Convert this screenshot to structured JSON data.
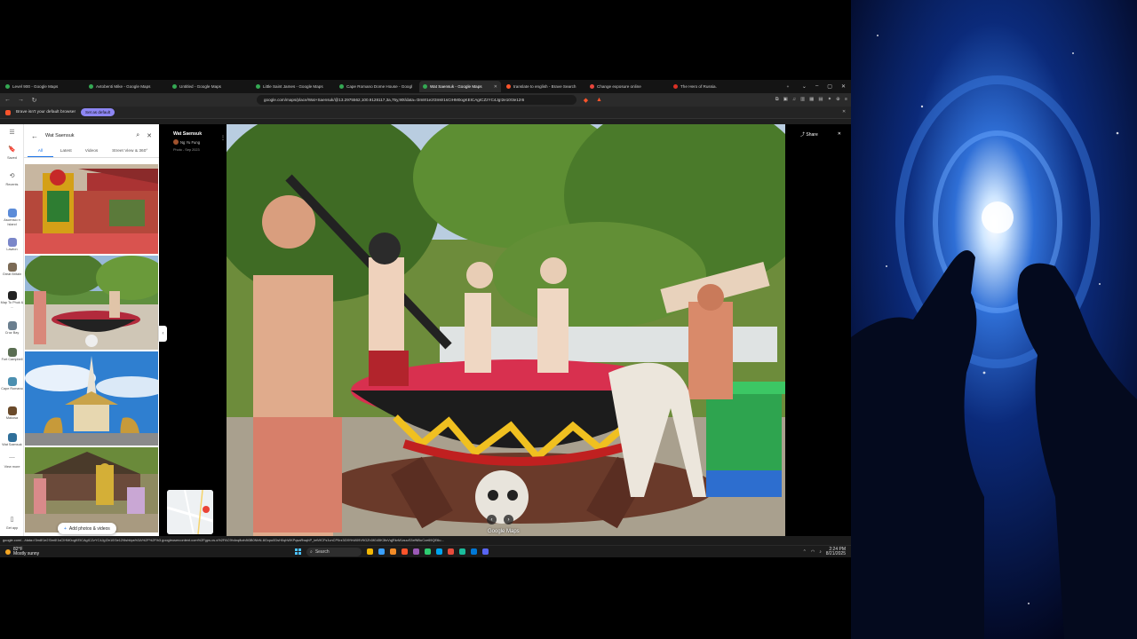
{
  "browser": {
    "tabs": [
      {
        "label": "Level 900 - Google Maps",
        "color": "#34a853",
        "active": false
      },
      {
        "label": "Avtobenti Mike - Google Maps",
        "color": "#34a853",
        "active": false
      },
      {
        "label": "Untitled - Google Maps",
        "color": "#34a853",
        "active": false
      },
      {
        "label": "Little Saint James - Google Maps",
        "color": "#34a853",
        "active": false
      },
      {
        "label": "Cape Romano Dome House - Googl",
        "color": "#34a853",
        "active": false
      },
      {
        "label": "Wat Saensuk - Google Maps",
        "color": "#34a853",
        "active": true
      },
      {
        "label": "translate to english - Brave Search",
        "color": "#fb542b",
        "active": false
      },
      {
        "label": "Change exposure online",
        "color": "#e8453c",
        "active": false
      },
      {
        "label": "The Hero of Russia.",
        "color": "#d93025",
        "active": false
      }
    ],
    "new_tab_glyph": "+",
    "url": "google.com/maps/place/Wat+Saensuk/@13.2975562,100.9128117,3a,75y,90t/data=!3m8!1e2!3m6!1sCIHM0ogKEICAgICZzYC4Jg!2e10!3e12!6",
    "banner": {
      "message": "Brave isn't your default browser",
      "button": "Set as default"
    }
  },
  "rail": {
    "items": [
      {
        "label": "Saved",
        "glyph": "🔖"
      },
      {
        "label": "Recents",
        "glyph": "⟲"
      },
      {
        "label": "Ascensio n Island",
        "color": "#5b8bd8"
      },
      {
        "label": "Lawton",
        "color": "#7a86c9"
      },
      {
        "label": "Great Britain",
        "color": "#7b6a55"
      },
      {
        "label": "Map To Phuk & ...",
        "color": "#222"
      },
      {
        "label": "Cruz Bay",
        "color": "#6b7f8f"
      },
      {
        "label": "Fort Campbell",
        "color": "#5a6e52"
      },
      {
        "label": "Cape Romano",
        "color": "#4b8fb0"
      },
      {
        "label": "Makosa",
        "color": "#6a4a2a"
      },
      {
        "label": "Wat Saensuk",
        "color": "#2f6f9a"
      },
      {
        "label": "View more",
        "glyph": "⋯"
      },
      {
        "label": "Get app",
        "glyph": "▯"
      }
    ]
  },
  "panel": {
    "search_query": "Wat Saensuk",
    "tabs": [
      "All",
      "Latest",
      "Videos",
      "Street View & 360°"
    ],
    "add_photos_label": "Add photos & videos"
  },
  "viewer": {
    "place": "Wat Saensuk",
    "author": "Ng Yu Fung",
    "date": "Photo - Sep 2023",
    "share_label": "Share",
    "watermark": "Google Maps"
  },
  "statusbar": {
    "text": "google.com/.../data=!3m8!1e2!3m6!1sCIHM0ogKEICAgICZzYC4Jg!2e10!3e12!6shttps%3A%2F%2Flh3.googleusercontent.com%2Fgps-cs-s%2FAC9h4nqfkzh8t3B0NbN-8Gxpu0DsH0qhWKPqsaRwqhP_tetVfCFs1vnCP0rz3GflYhW09V9GZh3fG45K3foVqjRkrM1auuS3xfNBuCce69QE6u..."
  },
  "taskbar": {
    "weather_temp": "82°F",
    "weather_desc": "Mostly sunny",
    "search_placeholder": "Search",
    "time": "2:24 PM",
    "date": "8/21/2025",
    "apps": [
      "#f2b705",
      "#3aa0ff",
      "#f28c28",
      "#fb542b",
      "#9b59b6",
      "#2ecc71",
      "#00a4ef",
      "#e74c3c",
      "#1abc9c",
      "#0078d7",
      "#5865f2"
    ]
  }
}
